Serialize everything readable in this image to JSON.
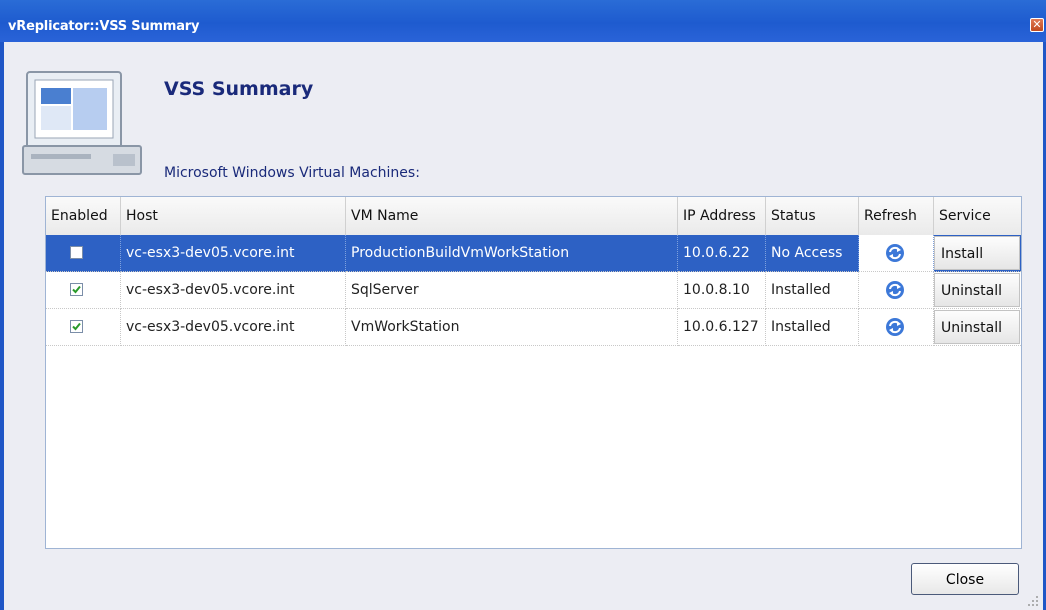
{
  "window": {
    "title": "vReplicator::VSS Summary"
  },
  "header": {
    "title": "VSS Summary",
    "subtitle": "Microsoft Windows Virtual Machines:"
  },
  "grid": {
    "columns": [
      "Enabled",
      "Host",
      "VM Name",
      "IP Address",
      "Status",
      "Refresh",
      "Service"
    ],
    "rows": [
      {
        "enabled": false,
        "host": "vc-esx3-dev05.vcore.int",
        "vm_name": "ProductionBuildVmWorkStation",
        "ip": "10.0.6.22",
        "status": "No Access",
        "service": "Install",
        "selected": true
      },
      {
        "enabled": true,
        "host": "vc-esx3-dev05.vcore.int",
        "vm_name": "SqlServer",
        "ip": "10.0.8.10",
        "status": "Installed",
        "service": "Uninstall",
        "selected": false
      },
      {
        "enabled": true,
        "host": "vc-esx3-dev05.vcore.int",
        "vm_name": "VmWorkStation",
        "ip": "10.0.6.127",
        "status": "Installed",
        "service": "Uninstall",
        "selected": false
      }
    ]
  },
  "footer": {
    "close_label": "Close"
  },
  "icons": {
    "computer": "computer-icon",
    "refresh": "refresh-icon",
    "close": "close-icon"
  },
  "colors": {
    "titlebar": "#1e5bcf",
    "selection": "#2d61c4",
    "heading": "#1a2a7a",
    "check": "#2a9a2a"
  }
}
